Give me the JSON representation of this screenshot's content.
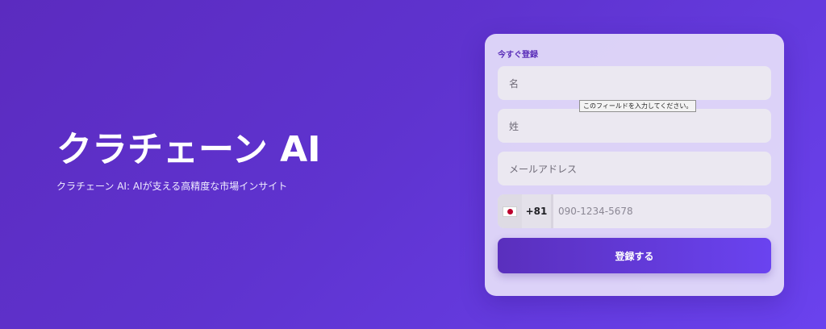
{
  "hero": {
    "title": "クラチェーン AI",
    "subtitle": "クラチェーン AI: AIが支える高精度な市場インサイト"
  },
  "form": {
    "heading": "今すぐ登録",
    "first_name_placeholder": "名",
    "last_name_placeholder": "姓",
    "email_placeholder": "メールアドレス",
    "tooltip": "このフィールドを入力してください。",
    "phone": {
      "flag_icon": "japan-flag-icon",
      "dial_code": "+81",
      "placeholder": "090-1234-5678"
    },
    "submit_label": "登録する"
  },
  "colors": {
    "background_start": "#5b2bbf",
    "background_end": "#6a42ee",
    "accent": "#5a2eb8",
    "button_start": "#5a2fbd",
    "button_end": "#6a43f0"
  }
}
